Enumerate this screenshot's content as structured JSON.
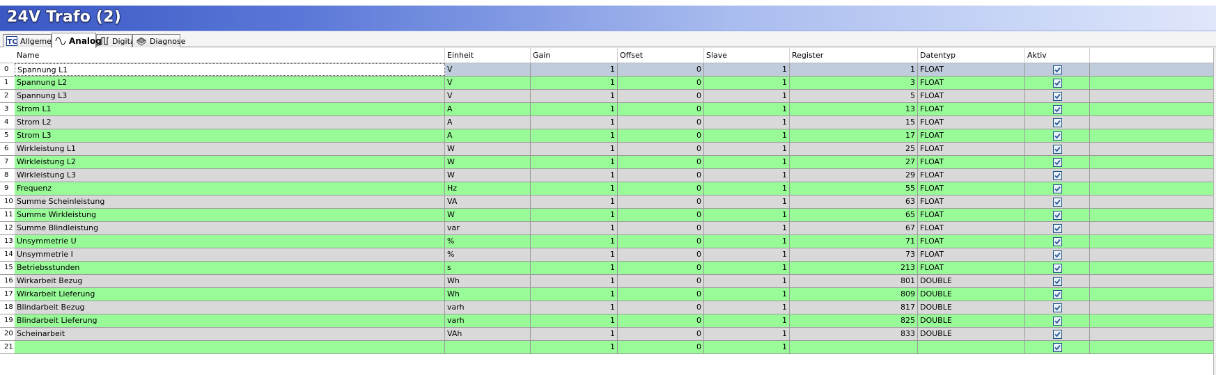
{
  "window": {
    "title": "24V Trafo (2)"
  },
  "tabs": [
    {
      "label": "Allgemein",
      "icon": "tc-logo-icon",
      "active": false
    },
    {
      "label": "Analog",
      "icon": "sine-wave-icon",
      "active": true
    },
    {
      "label": "Digital",
      "icon": "pulse-icon",
      "active": false
    },
    {
      "label": "Diagnose",
      "icon": "chip-icon",
      "active": false
    }
  ],
  "table": {
    "columns": [
      "Name",
      "Einheit",
      "Gain",
      "Offset",
      "Slave",
      "Register",
      "Datentyp",
      "Aktiv"
    ],
    "rows": [
      {
        "idx": "0",
        "name": "Spannung L1",
        "einheit": "V",
        "gain": "1",
        "offset": "0",
        "slave": "1",
        "register": "1",
        "datentyp": "FLOAT",
        "aktiv": true
      },
      {
        "idx": "1",
        "name": "Spannung L2",
        "einheit": "V",
        "gain": "1",
        "offset": "0",
        "slave": "1",
        "register": "3",
        "datentyp": "FLOAT",
        "aktiv": true
      },
      {
        "idx": "2",
        "name": "Spannung L3",
        "einheit": "V",
        "gain": "1",
        "offset": "0",
        "slave": "1",
        "register": "5",
        "datentyp": "FLOAT",
        "aktiv": true
      },
      {
        "idx": "3",
        "name": "Strom L1",
        "einheit": "A",
        "gain": "1",
        "offset": "0",
        "slave": "1",
        "register": "13",
        "datentyp": "FLOAT",
        "aktiv": true
      },
      {
        "idx": "4",
        "name": "Strom L2",
        "einheit": "A",
        "gain": "1",
        "offset": "0",
        "slave": "1",
        "register": "15",
        "datentyp": "FLOAT",
        "aktiv": true
      },
      {
        "idx": "5",
        "name": "Strom L3",
        "einheit": "A",
        "gain": "1",
        "offset": "0",
        "slave": "1",
        "register": "17",
        "datentyp": "FLOAT",
        "aktiv": true
      },
      {
        "idx": "6",
        "name": "Wirkleistung L1",
        "einheit": "W",
        "gain": "1",
        "offset": "0",
        "slave": "1",
        "register": "25",
        "datentyp": "FLOAT",
        "aktiv": true
      },
      {
        "idx": "7",
        "name": "Wirkleistung L2",
        "einheit": "W",
        "gain": "1",
        "offset": "0",
        "slave": "1",
        "register": "27",
        "datentyp": "FLOAT",
        "aktiv": true
      },
      {
        "idx": "8",
        "name": "Wirkleistung L3",
        "einheit": "W",
        "gain": "1",
        "offset": "0",
        "slave": "1",
        "register": "29",
        "datentyp": "FLOAT",
        "aktiv": true
      },
      {
        "idx": "9",
        "name": "Frequenz",
        "einheit": "Hz",
        "gain": "1",
        "offset": "0",
        "slave": "1",
        "register": "55",
        "datentyp": "FLOAT",
        "aktiv": true
      },
      {
        "idx": "10",
        "name": "Summe Scheinleistung",
        "einheit": "VA",
        "gain": "1",
        "offset": "0",
        "slave": "1",
        "register": "63",
        "datentyp": "FLOAT",
        "aktiv": true
      },
      {
        "idx": "11",
        "name": "Summe Wirkleistung",
        "einheit": "W",
        "gain": "1",
        "offset": "0",
        "slave": "1",
        "register": "65",
        "datentyp": "FLOAT",
        "aktiv": true
      },
      {
        "idx": "12",
        "name": "Summe Blindleistung",
        "einheit": "var",
        "gain": "1",
        "offset": "0",
        "slave": "1",
        "register": "67",
        "datentyp": "FLOAT",
        "aktiv": true
      },
      {
        "idx": "13",
        "name": "Unsymmetrie U",
        "einheit": "%",
        "gain": "1",
        "offset": "0",
        "slave": "1",
        "register": "71",
        "datentyp": "FLOAT",
        "aktiv": true
      },
      {
        "idx": "14",
        "name": "Unsymmetrie I",
        "einheit": "%",
        "gain": "1",
        "offset": "0",
        "slave": "1",
        "register": "73",
        "datentyp": "FLOAT",
        "aktiv": true
      },
      {
        "idx": "15",
        "name": "Betriebsstunden",
        "einheit": "s",
        "gain": "1",
        "offset": "0",
        "slave": "1",
        "register": "213",
        "datentyp": "FLOAT",
        "aktiv": true
      },
      {
        "idx": "16",
        "name": "Wirkarbeit Bezug",
        "einheit": "Wh",
        "gain": "1",
        "offset": "0",
        "slave": "1",
        "register": "801",
        "datentyp": "DOUBLE",
        "aktiv": true
      },
      {
        "idx": "17",
        "name": "Wirkarbeit Lieferung",
        "einheit": "Wh",
        "gain": "1",
        "offset": "0",
        "slave": "1",
        "register": "809",
        "datentyp": "DOUBLE",
        "aktiv": true
      },
      {
        "idx": "18",
        "name": "Blindarbeit Bezug",
        "einheit": "varh",
        "gain": "1",
        "offset": "0",
        "slave": "1",
        "register": "817",
        "datentyp": "DOUBLE",
        "aktiv": true
      },
      {
        "idx": "19",
        "name": "Blindarbeit Lieferung",
        "einheit": "varh",
        "gain": "1",
        "offset": "0",
        "slave": "1",
        "register": "825",
        "datentyp": "DOUBLE",
        "aktiv": true
      },
      {
        "idx": "20",
        "name": "Scheinarbeit",
        "einheit": "VAh",
        "gain": "1",
        "offset": "0",
        "slave": "1",
        "register": "833",
        "datentyp": "DOUBLE",
        "aktiv": true
      },
      {
        "idx": "21",
        "name": "",
        "einheit": "",
        "gain": "1",
        "offset": "0",
        "slave": "1",
        "register": "",
        "datentyp": "",
        "aktiv": true
      }
    ],
    "selected_row": 0
  },
  "colors": {
    "row_gray": "#d9d9d9",
    "row_green": "#98fb98",
    "row_selected": "#c0ccdb",
    "title_gradient_start": "#3a57c4",
    "check_mark": "#2a5a9a"
  }
}
